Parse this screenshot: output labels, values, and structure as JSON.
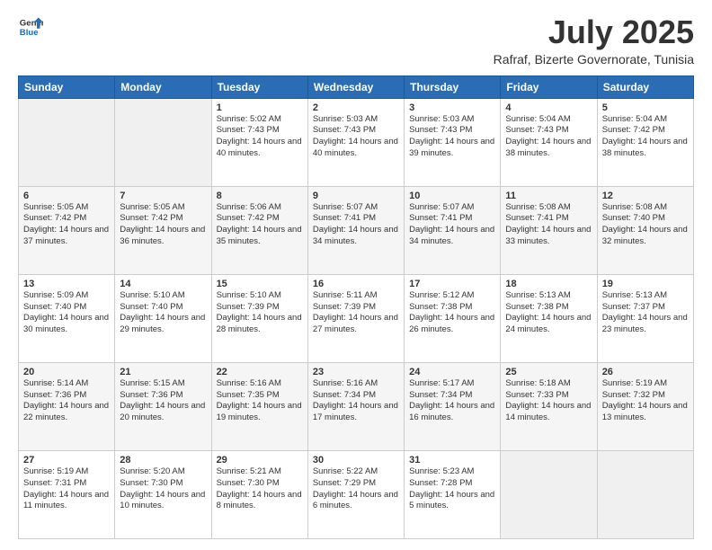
{
  "logo": {
    "line1": "General",
    "line2": "Blue"
  },
  "title": "July 2025",
  "location": "Rafraf, Bizerte Governorate, Tunisia",
  "headers": [
    "Sunday",
    "Monday",
    "Tuesday",
    "Wednesday",
    "Thursday",
    "Friday",
    "Saturday"
  ],
  "weeks": [
    [
      {
        "day": "",
        "sunrise": "",
        "sunset": "",
        "daylight": ""
      },
      {
        "day": "",
        "sunrise": "",
        "sunset": "",
        "daylight": ""
      },
      {
        "day": "1",
        "sunrise": "Sunrise: 5:02 AM",
        "sunset": "Sunset: 7:43 PM",
        "daylight": "Daylight: 14 hours and 40 minutes."
      },
      {
        "day": "2",
        "sunrise": "Sunrise: 5:03 AM",
        "sunset": "Sunset: 7:43 PM",
        "daylight": "Daylight: 14 hours and 40 minutes."
      },
      {
        "day": "3",
        "sunrise": "Sunrise: 5:03 AM",
        "sunset": "Sunset: 7:43 PM",
        "daylight": "Daylight: 14 hours and 39 minutes."
      },
      {
        "day": "4",
        "sunrise": "Sunrise: 5:04 AM",
        "sunset": "Sunset: 7:43 PM",
        "daylight": "Daylight: 14 hours and 38 minutes."
      },
      {
        "day": "5",
        "sunrise": "Sunrise: 5:04 AM",
        "sunset": "Sunset: 7:42 PM",
        "daylight": "Daylight: 14 hours and 38 minutes."
      }
    ],
    [
      {
        "day": "6",
        "sunrise": "Sunrise: 5:05 AM",
        "sunset": "Sunset: 7:42 PM",
        "daylight": "Daylight: 14 hours and 37 minutes."
      },
      {
        "day": "7",
        "sunrise": "Sunrise: 5:05 AM",
        "sunset": "Sunset: 7:42 PM",
        "daylight": "Daylight: 14 hours and 36 minutes."
      },
      {
        "day": "8",
        "sunrise": "Sunrise: 5:06 AM",
        "sunset": "Sunset: 7:42 PM",
        "daylight": "Daylight: 14 hours and 35 minutes."
      },
      {
        "day": "9",
        "sunrise": "Sunrise: 5:07 AM",
        "sunset": "Sunset: 7:41 PM",
        "daylight": "Daylight: 14 hours and 34 minutes."
      },
      {
        "day": "10",
        "sunrise": "Sunrise: 5:07 AM",
        "sunset": "Sunset: 7:41 PM",
        "daylight": "Daylight: 14 hours and 34 minutes."
      },
      {
        "day": "11",
        "sunrise": "Sunrise: 5:08 AM",
        "sunset": "Sunset: 7:41 PM",
        "daylight": "Daylight: 14 hours and 33 minutes."
      },
      {
        "day": "12",
        "sunrise": "Sunrise: 5:08 AM",
        "sunset": "Sunset: 7:40 PM",
        "daylight": "Daylight: 14 hours and 32 minutes."
      }
    ],
    [
      {
        "day": "13",
        "sunrise": "Sunrise: 5:09 AM",
        "sunset": "Sunset: 7:40 PM",
        "daylight": "Daylight: 14 hours and 30 minutes."
      },
      {
        "day": "14",
        "sunrise": "Sunrise: 5:10 AM",
        "sunset": "Sunset: 7:40 PM",
        "daylight": "Daylight: 14 hours and 29 minutes."
      },
      {
        "day": "15",
        "sunrise": "Sunrise: 5:10 AM",
        "sunset": "Sunset: 7:39 PM",
        "daylight": "Daylight: 14 hours and 28 minutes."
      },
      {
        "day": "16",
        "sunrise": "Sunrise: 5:11 AM",
        "sunset": "Sunset: 7:39 PM",
        "daylight": "Daylight: 14 hours and 27 minutes."
      },
      {
        "day": "17",
        "sunrise": "Sunrise: 5:12 AM",
        "sunset": "Sunset: 7:38 PM",
        "daylight": "Daylight: 14 hours and 26 minutes."
      },
      {
        "day": "18",
        "sunrise": "Sunrise: 5:13 AM",
        "sunset": "Sunset: 7:38 PM",
        "daylight": "Daylight: 14 hours and 24 minutes."
      },
      {
        "day": "19",
        "sunrise": "Sunrise: 5:13 AM",
        "sunset": "Sunset: 7:37 PM",
        "daylight": "Daylight: 14 hours and 23 minutes."
      }
    ],
    [
      {
        "day": "20",
        "sunrise": "Sunrise: 5:14 AM",
        "sunset": "Sunset: 7:36 PM",
        "daylight": "Daylight: 14 hours and 22 minutes."
      },
      {
        "day": "21",
        "sunrise": "Sunrise: 5:15 AM",
        "sunset": "Sunset: 7:36 PM",
        "daylight": "Daylight: 14 hours and 20 minutes."
      },
      {
        "day": "22",
        "sunrise": "Sunrise: 5:16 AM",
        "sunset": "Sunset: 7:35 PM",
        "daylight": "Daylight: 14 hours and 19 minutes."
      },
      {
        "day": "23",
        "sunrise": "Sunrise: 5:16 AM",
        "sunset": "Sunset: 7:34 PM",
        "daylight": "Daylight: 14 hours and 17 minutes."
      },
      {
        "day": "24",
        "sunrise": "Sunrise: 5:17 AM",
        "sunset": "Sunset: 7:34 PM",
        "daylight": "Daylight: 14 hours and 16 minutes."
      },
      {
        "day": "25",
        "sunrise": "Sunrise: 5:18 AM",
        "sunset": "Sunset: 7:33 PM",
        "daylight": "Daylight: 14 hours and 14 minutes."
      },
      {
        "day": "26",
        "sunrise": "Sunrise: 5:19 AM",
        "sunset": "Sunset: 7:32 PM",
        "daylight": "Daylight: 14 hours and 13 minutes."
      }
    ],
    [
      {
        "day": "27",
        "sunrise": "Sunrise: 5:19 AM",
        "sunset": "Sunset: 7:31 PM",
        "daylight": "Daylight: 14 hours and 11 minutes."
      },
      {
        "day": "28",
        "sunrise": "Sunrise: 5:20 AM",
        "sunset": "Sunset: 7:30 PM",
        "daylight": "Daylight: 14 hours and 10 minutes."
      },
      {
        "day": "29",
        "sunrise": "Sunrise: 5:21 AM",
        "sunset": "Sunset: 7:30 PM",
        "daylight": "Daylight: 14 hours and 8 minutes."
      },
      {
        "day": "30",
        "sunrise": "Sunrise: 5:22 AM",
        "sunset": "Sunset: 7:29 PM",
        "daylight": "Daylight: 14 hours and 6 minutes."
      },
      {
        "day": "31",
        "sunrise": "Sunrise: 5:23 AM",
        "sunset": "Sunset: 7:28 PM",
        "daylight": "Daylight: 14 hours and 5 minutes."
      },
      {
        "day": "",
        "sunrise": "",
        "sunset": "",
        "daylight": ""
      },
      {
        "day": "",
        "sunrise": "",
        "sunset": "",
        "daylight": ""
      }
    ]
  ]
}
